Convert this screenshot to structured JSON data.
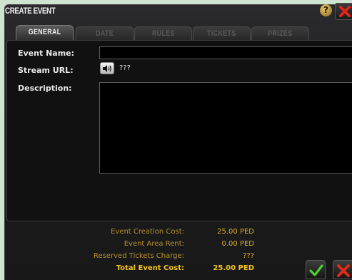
{
  "window": {
    "title": "CREATE EVENT"
  },
  "tabs": [
    {
      "label": "GENERAL",
      "active": true
    },
    {
      "label": "DATE",
      "active": false
    },
    {
      "label": "RULES",
      "active": false
    },
    {
      "label": "TICKETS",
      "active": false
    },
    {
      "label": "PRIZES",
      "active": false
    }
  ],
  "form": {
    "event_name_label": "Event Name:",
    "event_name_value": "",
    "stream_url_label": "Stream URL:",
    "stream_url_value": "???",
    "description_label": "Description:",
    "description_value": ""
  },
  "costs": [
    {
      "label": "Event Creation Cost:",
      "value": "25.00 PED"
    },
    {
      "label": "Event Area Rent:",
      "value": "0.00 PED"
    },
    {
      "label": "Reserved Tickets Charge:",
      "value": "???"
    }
  ],
  "total": {
    "label": "Total Event Cost:",
    "value": "25.00 PED"
  },
  "icons": {
    "help": "help-icon",
    "close": "close-icon",
    "speaker": "speaker-icon",
    "confirm": "checkmark-icon",
    "cancel": "cross-icon"
  },
  "colors": {
    "accent_gold": "#f2c318",
    "confirm_green": "#4bd12a",
    "cancel_red": "#e02a1a",
    "background": "#cfe4cf"
  }
}
